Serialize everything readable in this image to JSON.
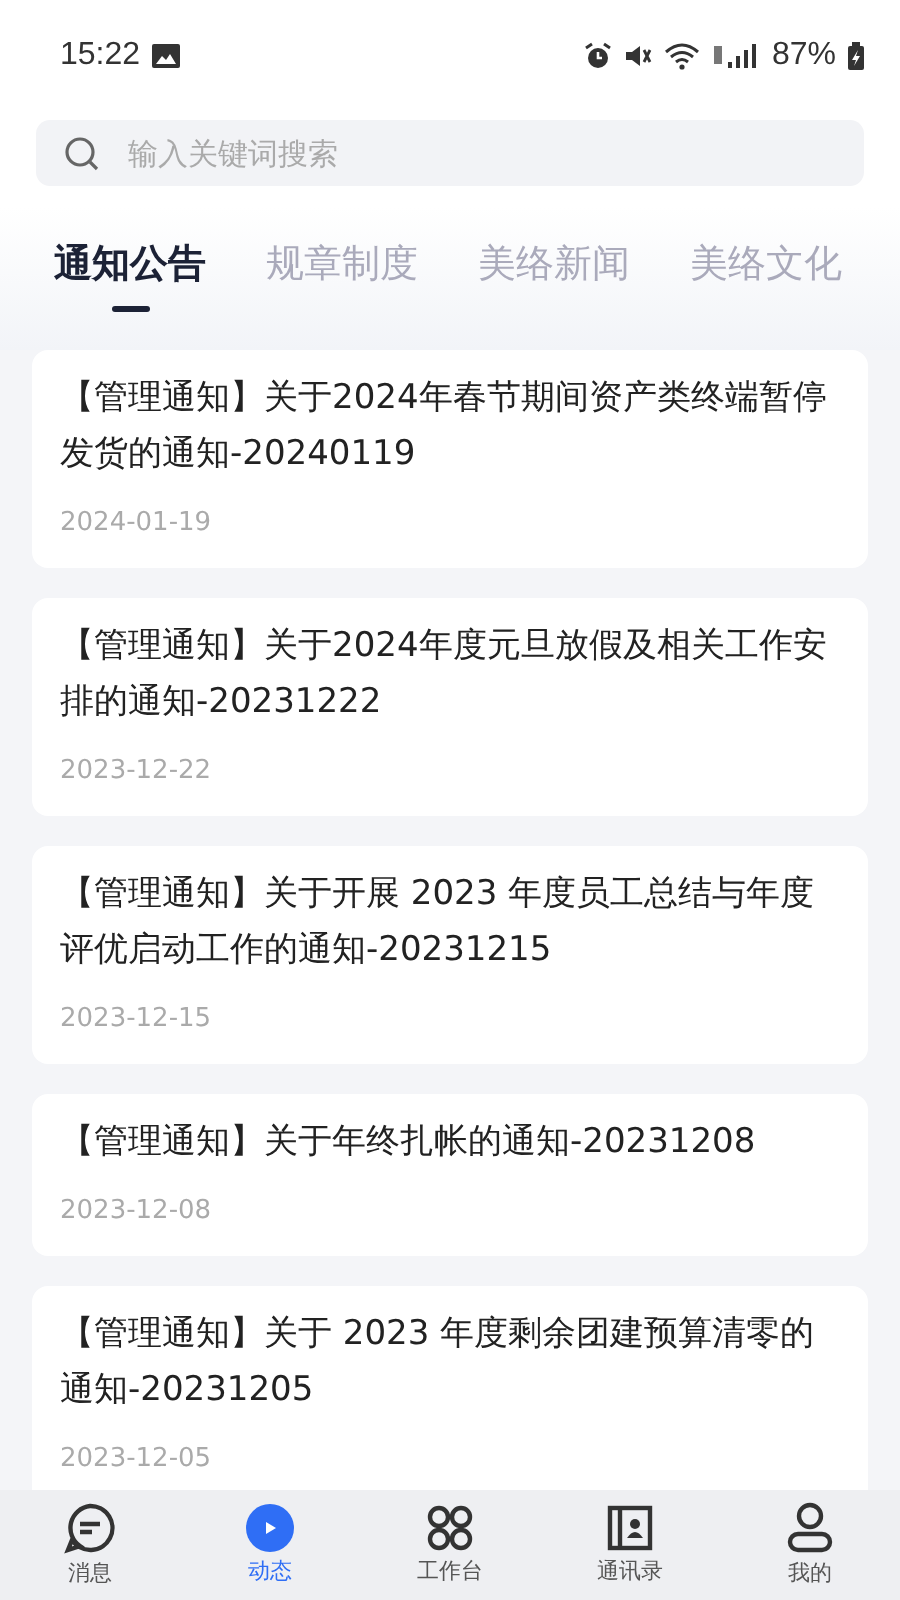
{
  "status_bar": {
    "time": "15:22",
    "battery": "87%"
  },
  "search": {
    "placeholder": "输入关键词搜索"
  },
  "tabs": [
    {
      "label": "通知公告",
      "selected": true
    },
    {
      "label": "规章制度",
      "selected": false
    },
    {
      "label": "美络新闻",
      "selected": false
    },
    {
      "label": "美络文化",
      "selected": false
    }
  ],
  "notices": [
    {
      "title": "【管理通知】关于2024年春节期间资产类终端暂停发货的通知-20240119",
      "date": "2024-01-19"
    },
    {
      "title": "【管理通知】关于2024年度元旦放假及相关工作安排的通知-20231222",
      "date": "2023-12-22"
    },
    {
      "title": "【管理通知】关于开展 2023 年度员工总结与年度评优启动工作的通知-20231215",
      "date": "2023-12-15"
    },
    {
      "title": "【管理通知】关于年终扎帐的通知-20231208",
      "date": "2023-12-08"
    },
    {
      "title": "【管理通知】关于 2023 年度剩余团建预算清零的通知-20231205",
      "date": "2023-12-05"
    }
  ],
  "bottom_nav": [
    {
      "label": "消息",
      "selected": false
    },
    {
      "label": "动态",
      "selected": true
    },
    {
      "label": "工作台",
      "selected": false
    },
    {
      "label": "通讯录",
      "selected": false
    },
    {
      "label": "我的",
      "selected": false
    }
  ]
}
